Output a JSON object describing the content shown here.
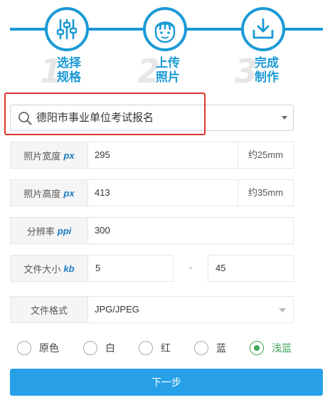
{
  "steps": [
    {
      "number": "1",
      "line1": "选择",
      "line2": "规格",
      "icon": "sliders-icon"
    },
    {
      "number": "2",
      "line1": "上传",
      "line2": "照片",
      "icon": "face-icon"
    },
    {
      "number": "3",
      "line1": "完成",
      "line2": "制作",
      "icon": "download-icon"
    }
  ],
  "search": {
    "value": "德阳市事业单位考试报名"
  },
  "form": {
    "width": {
      "label": "照片宽度",
      "unit": "px",
      "value": "295",
      "approx": "约25mm"
    },
    "height": {
      "label": "照片高度",
      "unit": "px",
      "value": "413",
      "approx": "约35mm"
    },
    "dpi": {
      "label": "分辨率",
      "unit": "ppi",
      "value": "300"
    },
    "size": {
      "label": "文件大小",
      "unit": "kb",
      "min": "5",
      "separator": "-",
      "max": "45"
    },
    "format": {
      "label": "文件格式",
      "value": "JPG/JPEG"
    }
  },
  "colors": {
    "selected": "浅蓝",
    "options": [
      "原色",
      "白",
      "红",
      "蓝",
      "浅蓝"
    ]
  },
  "next_button": {
    "label": "下一步"
  },
  "theme": {
    "accent": "#1b9ad6",
    "button": "#27a0e8",
    "selected_radio": "#3fa55b",
    "highlight": "#e0342d"
  }
}
